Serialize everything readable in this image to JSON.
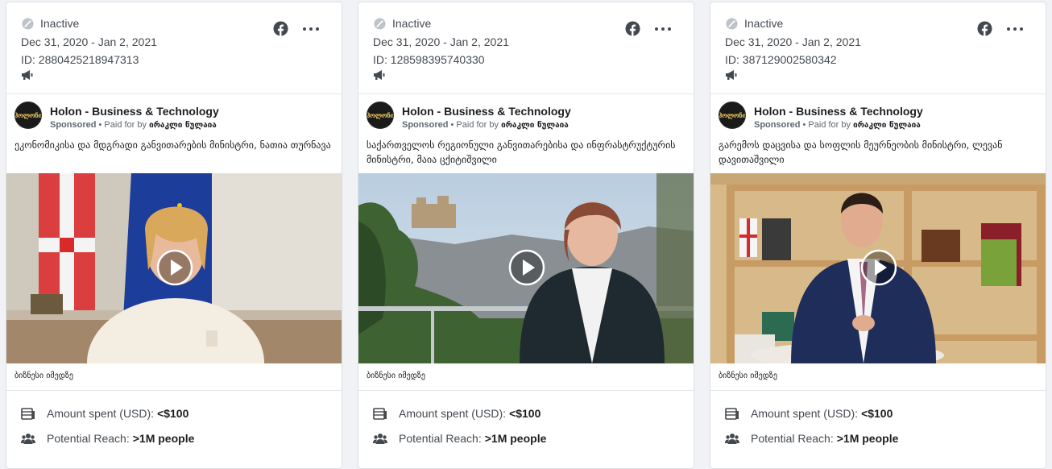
{
  "cards": [
    {
      "status": "Inactive",
      "date_range": "Dec 31, 2020 - Jan 2, 2021",
      "ad_id": "ID: 2880425218947313",
      "page_name": "Holon - Business & Technology",
      "sponsored_label": "Sponsored",
      "paid_for_by_label": " • Paid for by ",
      "payer": "ირაკლი წულაია",
      "avatar_text": "ჰოლონი",
      "body": "ეკონომიკისა და მდგრადი განვითარების მინისტრი, ნათია თურნავა",
      "caption": "ბიზნესი იმედზე",
      "amount_label": "Amount spent (USD):",
      "amount_value": "<$100",
      "reach_label": "Potential Reach:",
      "reach_value": ">1M people"
    },
    {
      "status": "Inactive",
      "date_range": "Dec 31, 2020 - Jan 2, 2021",
      "ad_id": "ID: 128598395740330",
      "page_name": "Holon - Business & Technology",
      "sponsored_label": "Sponsored",
      "paid_for_by_label": " • Paid for by ",
      "payer": "ირაკლი წულაია",
      "avatar_text": "ჰოლონი",
      "body": "საქართველოს რეგიონული განვითარებისა და ინფრასტრუქტურის მინისტრი, მაია ცქიტიშვილი",
      "caption": "ბიზნესი იმედზე",
      "amount_label": "Amount spent (USD):",
      "amount_value": "<$100",
      "reach_label": "Potential Reach:",
      "reach_value": ">1M people"
    },
    {
      "status": "Inactive",
      "date_range": "Dec 31, 2020 - Jan 2, 2021",
      "ad_id": "ID: 387129002580342",
      "page_name": "Holon - Business & Technology",
      "sponsored_label": "Sponsored",
      "paid_for_by_label": " • Paid for by ",
      "payer": "ირაკლი წულაია",
      "avatar_text": "ჰოლონი",
      "body": "გარემოს დაცვისა და სოფლის მეურნეობის მინისტრი, ლევან დავითაშვილი",
      "caption": "ბიზნესი იმედზე",
      "amount_label": "Amount spent (USD):",
      "amount_value": "<$100",
      "reach_label": "Potential Reach:",
      "reach_value": ">1M people"
    }
  ],
  "icons": {
    "status": "inactive-icon",
    "platform": "facebook-icon",
    "menu": "more-options-icon",
    "ad_type": "megaphone-icon",
    "play": "play-icon",
    "amount": "money-stack-icon",
    "reach": "people-icon"
  },
  "colors": {
    "background": "#f0f2f5",
    "card": "#ffffff",
    "text_secondary": "#444950"
  }
}
